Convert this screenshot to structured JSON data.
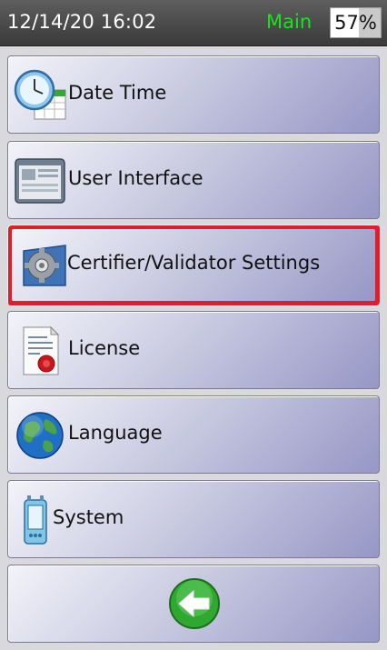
{
  "status": {
    "datetime": "12/14/20 16:02",
    "mode": "Main",
    "battery_percent": 57,
    "battery_label": "57%"
  },
  "menu": {
    "items": [
      {
        "label": "Date Time",
        "icon": "calendar-clock-icon"
      },
      {
        "label": "User Interface",
        "icon": "window-icon"
      },
      {
        "label": "Certifier/Validator Settings",
        "icon": "gear-settings-icon",
        "selected": true
      },
      {
        "label": "License",
        "icon": "certificate-icon"
      },
      {
        "label": "Language",
        "icon": "globe-icon"
      },
      {
        "label": "System",
        "icon": "handheld-device-icon"
      }
    ],
    "back_icon": "back-arrow-icon"
  },
  "colors": {
    "mode_text": "#19e619",
    "selection_border": "#e01d2b"
  }
}
